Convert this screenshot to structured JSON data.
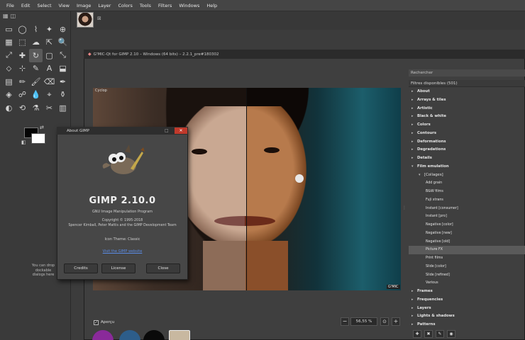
{
  "menubar": {
    "items": [
      "File",
      "Edit",
      "Select",
      "View",
      "Image",
      "Layer",
      "Colors",
      "Tools",
      "Filters",
      "Windows",
      "Help"
    ]
  },
  "gmic": {
    "title": "G'MIC-Qt for GIMP 2.10 – Windows (64 bits) – 2.2.1_pre#180302",
    "preview_label": "Cyclop",
    "preview_corner": "G'MIC",
    "apercu_label": "Aperçu",
    "zoom_value": "56,55 %",
    "search_label": "Rechercher",
    "filters_header": "Filtres disponibles (501)",
    "tree": [
      {
        "label": "About",
        "level": 0,
        "arrow": "▸",
        "selected": false
      },
      {
        "label": "Arrays & tiles",
        "level": 0,
        "arrow": "▸",
        "selected": false
      },
      {
        "label": "Artistic",
        "level": 0,
        "arrow": "▸",
        "selected": false
      },
      {
        "label": "Black & white",
        "level": 0,
        "arrow": "▸",
        "selected": false
      },
      {
        "label": "Colors",
        "level": 0,
        "arrow": "▸",
        "selected": false
      },
      {
        "label": "Contours",
        "level": 0,
        "arrow": "▸",
        "selected": false
      },
      {
        "label": "Deformations",
        "level": 0,
        "arrow": "▸",
        "selected": false
      },
      {
        "label": "Degradations",
        "level": 0,
        "arrow": "▸",
        "selected": false
      },
      {
        "label": "Details",
        "level": 0,
        "arrow": "▸",
        "selected": false
      },
      {
        "label": "Film emulation",
        "level": 0,
        "arrow": "▾",
        "selected": false
      },
      {
        "label": "[Collages]",
        "level": 1,
        "arrow": "▾",
        "selected": false
      },
      {
        "label": "Add grain",
        "level": 2,
        "arrow": "",
        "selected": false
      },
      {
        "label": "B&W films",
        "level": 2,
        "arrow": "",
        "selected": false
      },
      {
        "label": "Fuji xtrans",
        "level": 2,
        "arrow": "",
        "selected": false
      },
      {
        "label": "Instant [consumer]",
        "level": 2,
        "arrow": "",
        "selected": false
      },
      {
        "label": "Instant [pro]",
        "level": 2,
        "arrow": "",
        "selected": false
      },
      {
        "label": "Negative [color]",
        "level": 2,
        "arrow": "",
        "selected": false
      },
      {
        "label": "Negative [new]",
        "level": 2,
        "arrow": "",
        "selected": false
      },
      {
        "label": "Negative [old]",
        "level": 2,
        "arrow": "",
        "selected": false
      },
      {
        "label": "Picture FX",
        "level": 2,
        "arrow": "",
        "selected": true
      },
      {
        "label": "Print films",
        "level": 2,
        "arrow": "",
        "selected": false
      },
      {
        "label": "Slide [color]",
        "level": 2,
        "arrow": "",
        "selected": false
      },
      {
        "label": "Slide [refined]",
        "level": 2,
        "arrow": "",
        "selected": false
      },
      {
        "label": "Various",
        "level": 2,
        "arrow": "",
        "selected": false
      },
      {
        "label": "Frames",
        "level": 0,
        "arrow": "▸",
        "selected": false
      },
      {
        "label": "Frequencies",
        "level": 0,
        "arrow": "▸",
        "selected": false
      },
      {
        "label": "Layers",
        "level": 0,
        "arrow": "▸",
        "selected": false
      },
      {
        "label": "Lights & shadows",
        "level": 0,
        "arrow": "▸",
        "selected": false
      },
      {
        "label": "Patterns",
        "level": 0,
        "arrow": "▸",
        "selected": false
      }
    ]
  },
  "toolbox": {
    "tools": [
      "▭",
      "◯",
      "⌇",
      "✦",
      "⊕",
      "▦",
      "⬚",
      "☁",
      "⇱",
      "🔍",
      "⤢",
      "✚",
      "↻",
      "▢",
      "⤡",
      "⬦",
      "⊹",
      "✎",
      "A",
      "⬓",
      "▤",
      "✏",
      "🖌",
      "⌫",
      "✒",
      "◈",
      "☍",
      "💧",
      "⌖",
      "⚱",
      "◐",
      "⟲",
      "⚗",
      "✂",
      "▥"
    ],
    "dropzone": "You can drop dockable dialogs here"
  },
  "about": {
    "title": "About GIMP",
    "name": "GIMP 2.10.0",
    "subtitle": "GNU Image Manipulation Program",
    "copyright1": "Copyright © 1995-2018",
    "copyright2": "Spencer Kimball, Peter Mattis and the GIMP Development Team",
    "theme": "Icon Theme: Classic",
    "link": "Visit the GIMP website",
    "buttons": {
      "credits": "Credits",
      "license": "License",
      "close": "Close"
    }
  },
  "colors": {
    "window_bg": "#3c3c3c",
    "panel_bg": "#3f3f3f",
    "selected_row": "#5a5a5a",
    "link": "#5b8de8",
    "close_red": "#c0392b"
  }
}
